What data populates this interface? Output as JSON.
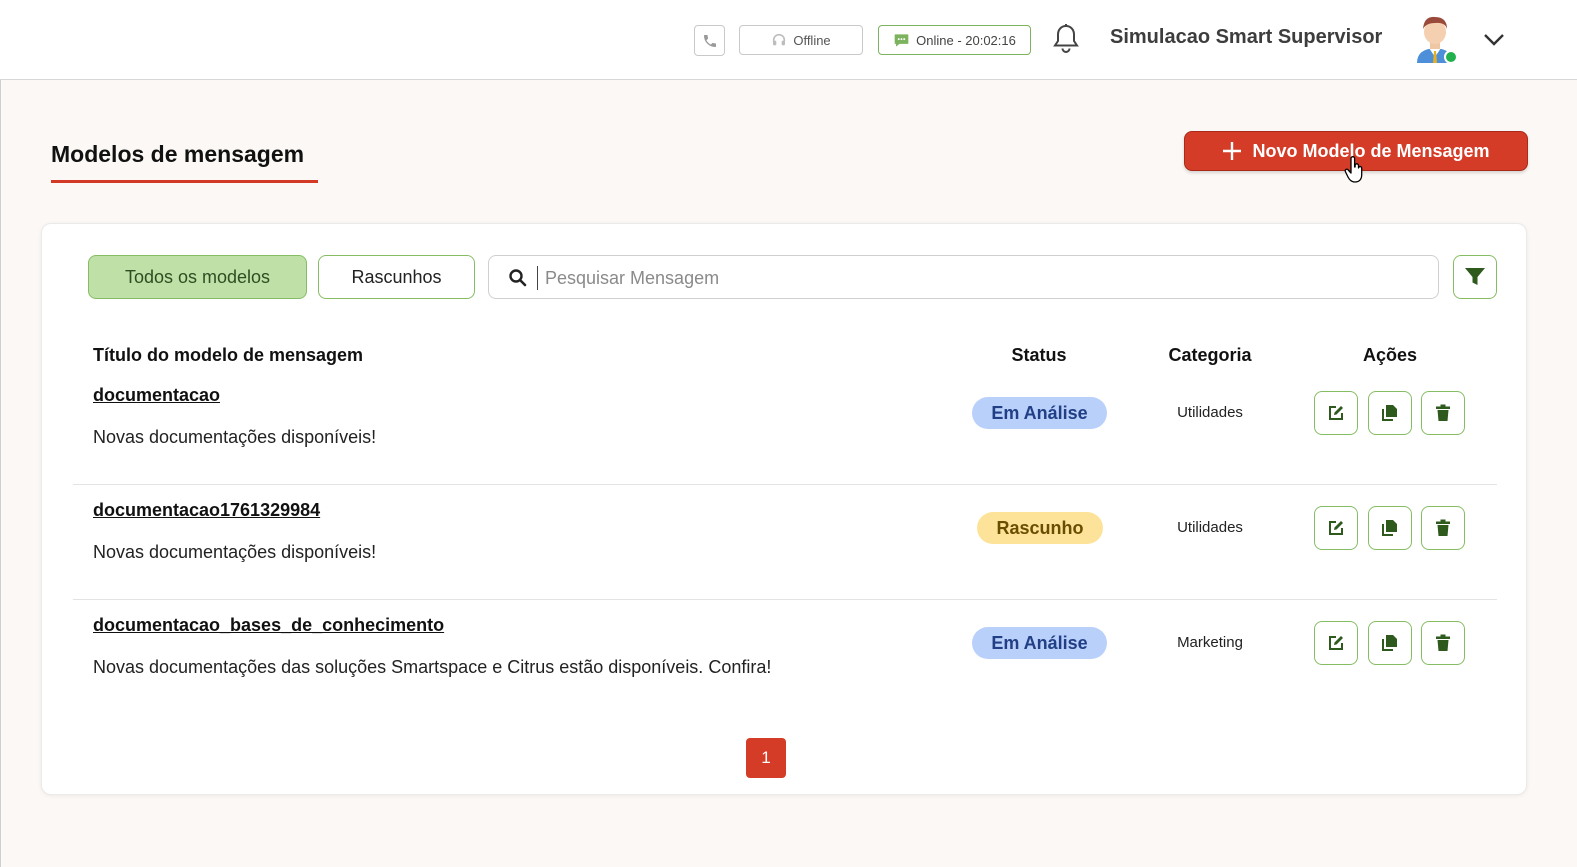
{
  "header": {
    "offline_label": "Offline",
    "online_label": "Online - 20:02:16",
    "user_name": "Simulacao Smart Supervisor",
    "online_color": "#7cb35f",
    "status_dot_color": "#22b14c"
  },
  "page": {
    "title": "Modelos de mensagem",
    "new_button_label": "Novo Modelo de Mensagem",
    "accent_color": "#d43c27"
  },
  "filters": {
    "tabs": [
      {
        "label": "Todos os modelos",
        "active": true
      },
      {
        "label": "Rascunhos",
        "active": false
      }
    ],
    "search_placeholder": "Pesquisar Mensagem",
    "search_value": ""
  },
  "table": {
    "columns": {
      "title": "Título do modelo de mensagem",
      "status": "Status",
      "category": "Categoria",
      "actions": "Ações"
    },
    "rows": [
      {
        "title": "documentacao",
        "description": "Novas documentações disponíveis!",
        "status": "Em Análise",
        "category": "Utilidades"
      },
      {
        "title": "documentacao1761329984",
        "description": "Novas documentações disponíveis!",
        "status": "Rascunho",
        "category": "Utilidades"
      },
      {
        "title": "documentacao_bases_de_conhecimento",
        "description": "Novas documentações das soluções Smartspace e Citrus estão disponíveis. Confira!",
        "status": "Em Análise",
        "category": "Marketing"
      }
    ]
  },
  "pagination": {
    "current_page": "1"
  },
  "icons": [
    "phone-icon",
    "headset-icon",
    "chat-icon",
    "bell-icon",
    "avatar",
    "chevron-down-icon",
    "plus-icon",
    "search-icon",
    "filter-icon",
    "edit-icon",
    "copy-icon",
    "trash-icon"
  ]
}
